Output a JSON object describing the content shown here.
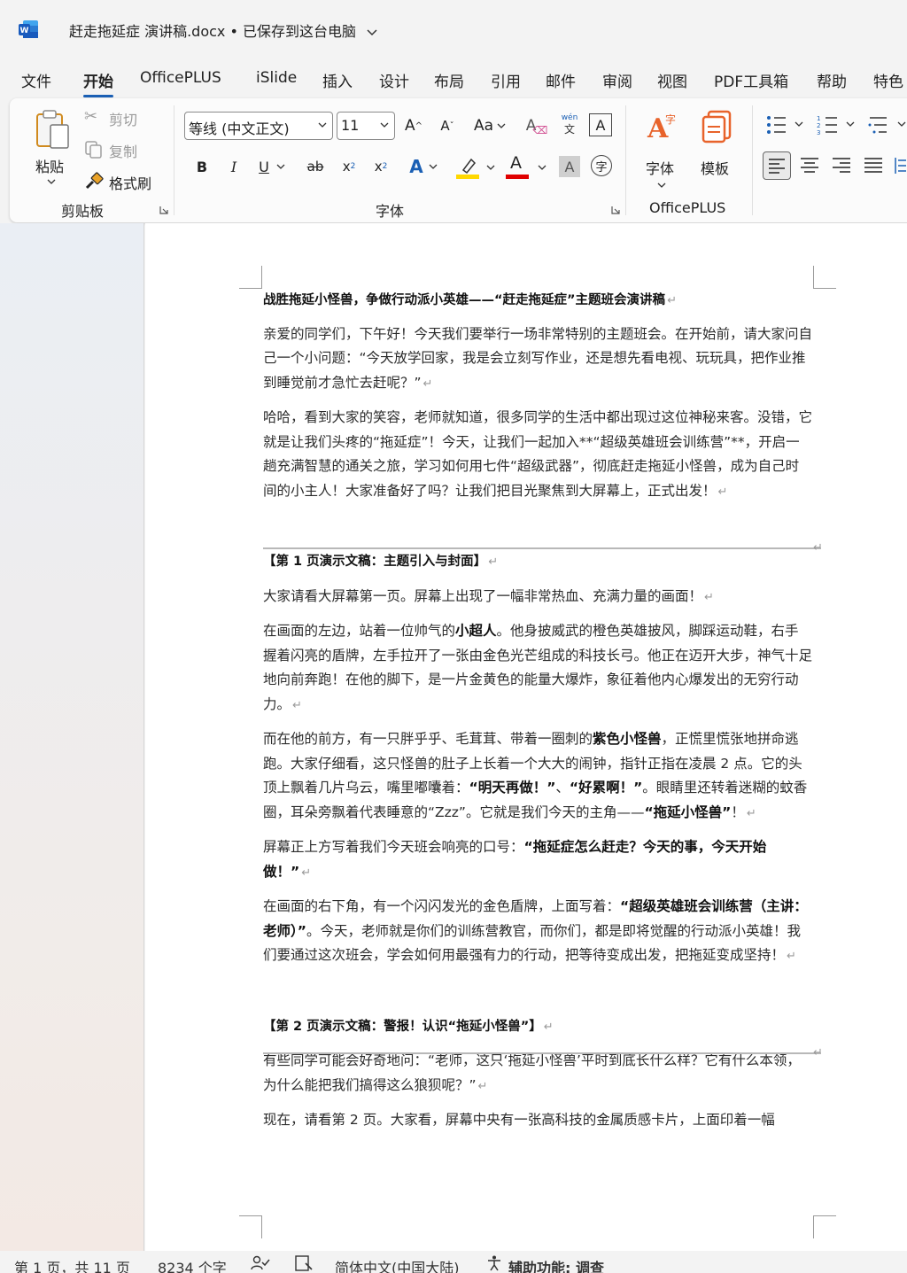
{
  "window": {
    "title": "赶走拖延症 演讲稿.docx",
    "save_status": "• 已保存到这台电脑"
  },
  "menu": {
    "tabs": [
      "文件",
      "开始",
      "OfficePLUS",
      "iSlide",
      "插入",
      "设计",
      "布局",
      "引用",
      "邮件",
      "审阅",
      "视图",
      "PDF工具箱",
      "帮助",
      "特色"
    ]
  },
  "ribbon": {
    "clipboard": {
      "paste": "粘贴",
      "cut": "剪切",
      "copy": "复制",
      "format_painter": "格式刷",
      "group_label": "剪贴板"
    },
    "font": {
      "font_name": "等线 (中文正文)",
      "font_size": "11",
      "change_case": "Aa",
      "group_label": "字体",
      "phonetic_top": "wén",
      "phonetic_bottom": "文"
    },
    "officeplus": {
      "font_btn": "字体",
      "template_btn": "模板",
      "group_label": "OfficePLUS"
    },
    "colors": {
      "highlight": "#ffd800",
      "font_color": "#e00000",
      "accent_blue": "#1a5fb4",
      "officeplus_orange": "#e8632b"
    }
  },
  "document": {
    "heading": "战胜拖延小怪兽，争做行动派小英雄——“赶走拖延症”主题班会演讲稿",
    "para1": "亲爱的同学们，下午好！今天我们要举行一场非常特别的主题班会。在开始前，请大家问自己一个小问题：“今天放学回家，我是会立刻写作业，还是想先看电视、玩玩具，把作业推到睡觉前才急忙去赶呢？”",
    "para2": "哈哈，看到大家的笑容，老师就知道，很多同学的生活中都出现过这位神秘来客。没错，它就是让我们头疼的“拖延症”！今天，让我们一起加入**“超级英雄班会训练营”**，开启一趟充满智慧的通关之旅，学习如何用七件“超级武器”，彻底赶走拖延小怪兽，成为自己时间的小主人！大家准备好了吗？让我们把目光聚焦到大屏幕上，正式出发！",
    "section1_title": "【第 1 页演示文稿：主题引入与封面】",
    "s1_p1": "大家请看大屏幕第一页。屏幕上出现了一幅非常热血、充满力量的画面！",
    "s1_p2_a": "在画面的左边，站着一位帅气的",
    "s1_p2_b": "小超人",
    "s1_p2_c": "。他身披威武的橙色英雄披风，脚踩运动鞋，右手握着闪亮的盾牌，左手拉开了一张由金色光芒组成的科技长弓。他正在迈开大步，神气十足地向前奔跑！在他的脚下，是一片金黄色的能量大爆炸，象征着他内心爆发出的无穷行动力。",
    "s1_p3_a": "而在他的前方，有一只胖乎乎、毛茸茸、带着一圈刺的",
    "s1_p3_b": "紫色小怪兽",
    "s1_p3_c": "，正慌里慌张地拼命逃跑。大家仔细看，这只怪兽的肚子上长着一个大大的闹钟，指针正指在凌晨 2 点。它的头顶上飘着几片乌云，嘴里嘟囔着：",
    "s1_p3_d": "“明天再做！”",
    "s1_p3_e": "、",
    "s1_p3_f": "“好累啊！”",
    "s1_p3_g": "。眼睛里还转着迷糊的蚊香圈，耳朵旁飘着代表睡意的“Zzz”。它就是我们今天的主角——",
    "s1_p3_h": "“拖延小怪兽”",
    "s1_p3_i": "！",
    "s1_p4_a": "屏幕正上方写着我们今天班会响亮的口号：",
    "s1_p4_b": "“拖延症怎么赶走？今天的事，今天开始做！”",
    "s1_p5_a": "在画面的右下角，有一个闪闪发光的金色盾牌，上面写着：",
    "s1_p5_b": "“超级英雄班会训练营（主讲：老师）”",
    "s1_p5_c": "。今天，老师就是你们的训练营教官，而你们，都是即将觉醒的行动派小英雄！我们要通过这次班会，学会如何用最强有力的行动，把等待变成出发，把拖延变成坚持！",
    "section2_title": "【第 2 页演示文稿：警报！认识“拖延小怪兽”】",
    "s2_p1": "有些同学可能会好奇地问：“老师，这只‘拖延小怪兽’平时到底长什么样？它有什么本领，为什么能把我们搞得这么狼狈呢？”",
    "s2_p2": "现在，请看第 2 页。大家看，屏幕中央有一张高科技的金属质感卡片，上面印着一幅"
  },
  "status": {
    "page": "第 1 页，共 11 页",
    "words": "8234 个字",
    "language": "简体中文(中国大陆)",
    "accessibility": "辅助功能: 调查"
  }
}
